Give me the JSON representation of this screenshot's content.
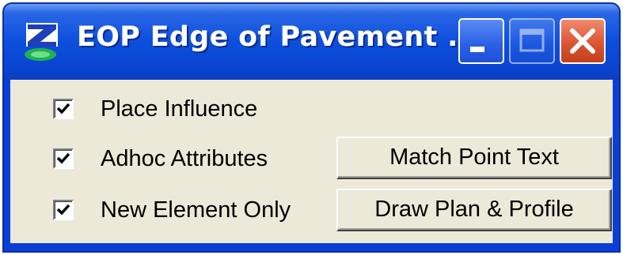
{
  "window": {
    "title": "EOP Edge of Pavement ...",
    "app_icon": "bentley-b-icon",
    "controls": {
      "minimize": "minimize-icon",
      "maximize": "maximize-icon",
      "close": "close-icon"
    }
  },
  "checkboxes": [
    {
      "label": "Place Influence",
      "checked": true
    },
    {
      "label": "Adhoc Attributes",
      "checked": true
    },
    {
      "label": "New Element Only",
      "checked": true
    }
  ],
  "buttons": {
    "match_point_text": "Match Point Text",
    "draw_plan_profile": "Draw Plan & Profile"
  },
  "colors": {
    "titlebar": "#0a44cf",
    "close_button": "#d9512e",
    "dialog_face": "#ece9d8"
  }
}
